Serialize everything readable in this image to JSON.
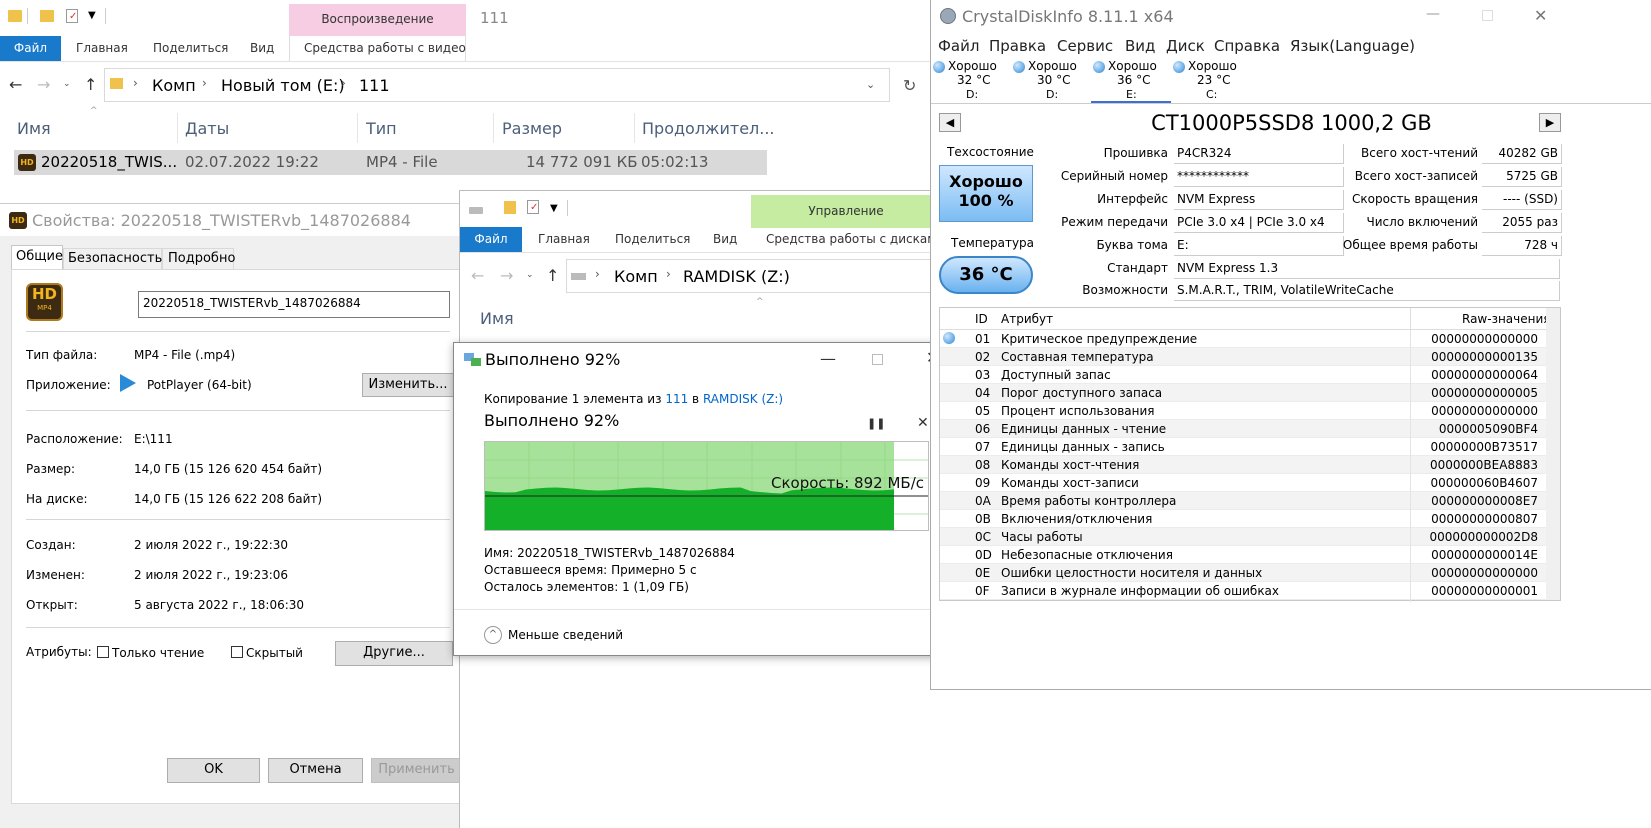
{
  "explorer1": {
    "tab_play": "Воспроизведение",
    "tab_111": "111",
    "ribbon": [
      "Файл",
      "Главная",
      "Поделиться",
      "Вид",
      "Средства работы с видео"
    ],
    "crumbs": [
      "Комп",
      "Новый том (E:)",
      "111"
    ],
    "cols": [
      "Имя",
      "Даты",
      "Тип",
      "Размер",
      "Продолжител..."
    ],
    "file": {
      "name": "20220518_TWIS...",
      "date": "02.07.2022 19:22",
      "type": "MP4 - File",
      "size": "14 772 091 КБ",
      "dur": "05:02:13"
    }
  },
  "props": {
    "title": "Свойства: 20220518_TWISTERvb_1487026884",
    "tabs": [
      "Общие",
      "Безопасность",
      "Подробно"
    ],
    "filename": "20220518_TWISTERvb_1487026884",
    "hd_line1": "HD",
    "hd_line2": "MP4",
    "type_label": "Тип файла:",
    "type_value": "MP4 - File (.mp4)",
    "app_label": "Приложение:",
    "app_value": "PotPlayer (64-bit)",
    "change": "Изменить...",
    "loc_label": "Расположение:",
    "loc_value": "E:\\111",
    "size_label": "Размер:",
    "size_value": "14,0 ГБ (15 126 620 454 байт)",
    "disk_label": "На диске:",
    "disk_value": "14,0 ГБ (15 126 622 208 байт)",
    "created_label": "Создан:",
    "created_value": "2 июля 2022 г., 19:22:30",
    "modified_label": "Изменен:",
    "modified_value": "2 июля 2022 г., 19:23:06",
    "opened_label": "Открыт:",
    "opened_value": "5 августа 2022 г., 18:06:30",
    "attr_label": "Атрибуты:",
    "readonly": "Только чтение",
    "hidden": "Скрытый",
    "other": "Другие...",
    "ok": "OK",
    "cancel": "Отмена",
    "apply": "Применить"
  },
  "explorer2": {
    "manage": "Управление",
    "ribbon": [
      "Файл",
      "Главная",
      "Поделиться",
      "Вид",
      "Средства работы с дисками"
    ],
    "crumbs": [
      "Комп",
      "RAMDISK (Z:)"
    ],
    "col_name": "Имя"
  },
  "copy": {
    "title": "Выполнено 92%",
    "line_pre": "Копирование",
    "line_count": "1",
    "line_el": "элемента из",
    "line_src": "111",
    "line_in": "в",
    "line_dst": "RAMDISK (Z:)",
    "heading": "Выполнено 92%",
    "speed": "Скорость: 892 МБ/с",
    "progress_pct": 92,
    "name_label": "Имя:",
    "name_value": "20220518_TWISTERvb_1487026884",
    "time_label": "Оставшееся время:",
    "time_value": "Примерно 5 с",
    "left_label": "Осталось элементов:",
    "left_value": "1 (1,09 ГБ)",
    "less": "Меньше сведений",
    "accent": "#06b025"
  },
  "cdi": {
    "title": "CrystalDiskInfo 8.11.1 x64",
    "menu": [
      "Файл",
      "Правка",
      "Сервис",
      "Вид",
      "Диск",
      "Справка",
      "Язык(Language)"
    ],
    "drives": [
      {
        "status": "Хорошо",
        "temp": "32 °C",
        "letter": "D:"
      },
      {
        "status": "Хорошо",
        "temp": "30 °C",
        "letter": "D:"
      },
      {
        "status": "Хорошо",
        "temp": "36 °C",
        "letter": "E:"
      },
      {
        "status": "Хорошо",
        "temp": "23 °C",
        "letter": "C:"
      }
    ],
    "model": "CT1000P5SSD8 1000,2 GB",
    "health_label": "Техсостояние",
    "health_status": "Хорошо",
    "health_pct": "100 %",
    "temp_label": "Температура",
    "temp_value": "36 °C",
    "fw_label": "Прошивка",
    "fw": "P4CR324",
    "sn_label": "Серийный номер",
    "sn": "************",
    "if_label": "Интерфейс",
    "if": "NVM Express",
    "mode_label": "Режим передачи",
    "mode": "PCIe 3.0 x4 | PCIe 3.0 x4",
    "letter_label": "Буква тома",
    "letter": "E:",
    "std_label": "Стандарт",
    "std": "NVM Express 1.3",
    "feat_label": "Возможности",
    "feat": "S.M.A.R.T., TRIM, VolatileWriteCache",
    "reads_label": "Всего хост-чтений",
    "reads": "40282 GB",
    "writes_label": "Всего хост-записей",
    "writes": "5725 GB",
    "rpm_label": "Скорость вращения",
    "rpm": "---- (SSD)",
    "count_label": "Число включений",
    "count": "2055 раз",
    "hours_label": "Общее время работы",
    "hours": "728 ч",
    "th_id": "ID",
    "th_attr": "Атрибут",
    "th_raw": "Raw-значения",
    "rows": [
      {
        "id": "01",
        "name": "Критическое предупреждение",
        "raw": "00000000000000"
      },
      {
        "id": "02",
        "name": "Составная температура",
        "raw": "00000000000135"
      },
      {
        "id": "03",
        "name": "Доступный запас",
        "raw": "00000000000064"
      },
      {
        "id": "04",
        "name": "Порог доступного запаса",
        "raw": "00000000000005"
      },
      {
        "id": "05",
        "name": "Процент использования",
        "raw": "00000000000000"
      },
      {
        "id": "06",
        "name": "Единицы данных - чтение",
        "raw": "0000005090BF4"
      },
      {
        "id": "07",
        "name": "Единицы данных - запись",
        "raw": "00000000B73517"
      },
      {
        "id": "08",
        "name": "Команды хост-чтения",
        "raw": "0000000BEA8883"
      },
      {
        "id": "09",
        "name": "Команды хост-записи",
        "raw": "000000060B4607"
      },
      {
        "id": "0A",
        "name": "Время работы контроллера",
        "raw": "000000000008E7"
      },
      {
        "id": "0B",
        "name": "Включения/отключения",
        "raw": "00000000000807"
      },
      {
        "id": "0C",
        "name": "Часы работы",
        "raw": "000000000002D8"
      },
      {
        "id": "0D",
        "name": "Небезопасные отключения",
        "raw": "0000000000014E"
      },
      {
        "id": "0E",
        "name": "Ошибки целостности носителя и данных",
        "raw": "00000000000000"
      },
      {
        "id": "0F",
        "name": "Записи в журнале информации об ошибках",
        "raw": "00000000000001"
      }
    ]
  }
}
